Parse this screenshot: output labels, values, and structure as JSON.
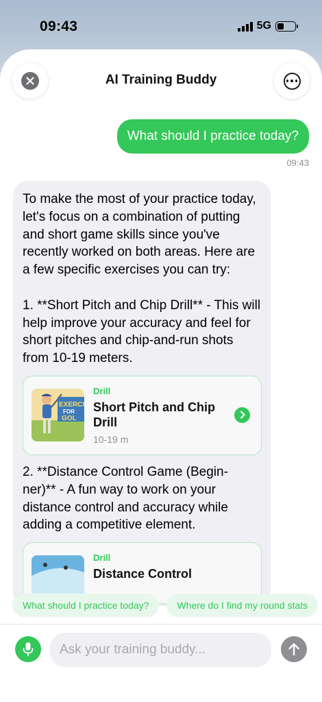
{
  "status_bar": {
    "time": "09:43",
    "network": "5G",
    "icons": [
      "signal-icon",
      "battery-icon"
    ]
  },
  "header": {
    "title": "AI Training Buddy",
    "close_icon": "close-icon",
    "more_icon": "more-icon"
  },
  "conversation": {
    "user_message": "What should I practice today?",
    "user_message_time": "09:43",
    "bot_intro": "To make the most of your practice today, let's focus on a combination of putting and short game skills since you've recently worked on both areas. Here are a few specific exercises you can try:\n\n1. **Short Pitch and Chip Drill** - This will help improve your accuracy and feel for short pitches and chip-and-run shots from 10-19 meters.",
    "drill_1": {
      "tag": "Drill",
      "title": "Short Pitch and Chip Drill",
      "subtitle": "10-19 m",
      "thumb_text": "EXERCI FOR GOL"
    },
    "bot_item_2": "2. **Distance Control Game (Begin-ner)** - A fun way to work on your distance control and accuracy while adding a competitive element.",
    "drill_2": {
      "tag": "Drill",
      "title": "Distance Control"
    }
  },
  "suggestions": [
    "What should I practice today?",
    "Where do I find my round stats"
  ],
  "composer": {
    "placeholder": "Ask your training buddy...",
    "mic_icon": "mic-icon",
    "send_icon": "send-arrow-icon"
  },
  "colors": {
    "accent": "#34c759",
    "bubble_bg": "#efeff4",
    "chip_bg": "#e8f7ec"
  }
}
